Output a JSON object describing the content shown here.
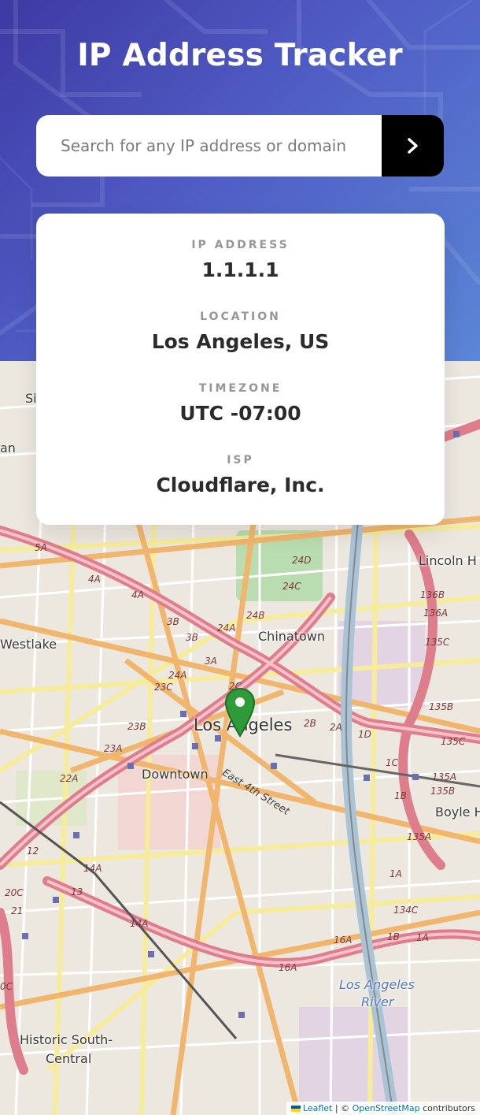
{
  "header": {
    "title": "IP Address Tracker"
  },
  "search": {
    "placeholder": "Search for any IP address or domain",
    "value": ""
  },
  "info": {
    "ip_label": "IP ADDRESS",
    "ip_value": "1.1.1.1",
    "location_label": "LOCATION",
    "location_value": "Los Angeles, US",
    "timezone_label": "TIMEZONE",
    "timezone_value": "UTC -07:00",
    "isp_label": "ISP",
    "isp_value": "Cloudflare, Inc."
  },
  "map": {
    "labels": {
      "westlake": "Westlake",
      "chinatown": "Chinatown",
      "los_angeles": "Los Angeles",
      "downtown": "Downtown",
      "lincoln": "Lincoln H",
      "boyle": "Boyle H",
      "historic_1": "Historic South-",
      "historic_2": "Central",
      "river_1": "Los Angeles",
      "river_2": "River",
      "east_4th": "East 4th Street",
      "si": "Si",
      "an": "an"
    },
    "roads": [
      "5A",
      "4A",
      "4A",
      "3B",
      "3B",
      "3A",
      "24A",
      "23C",
      "23B",
      "23A",
      "22A",
      "24A",
      "24B",
      "24C",
      "24D",
      "2C",
      "2B",
      "2A",
      "1D",
      "1C",
      "1B",
      "1A",
      "136B",
      "136A",
      "135C",
      "135B",
      "135C",
      "135A",
      "135B",
      "135A",
      "134C",
      "16A",
      "16A",
      "1B",
      "1A",
      "14A",
      "14A",
      "13",
      "20C",
      "21",
      "12",
      "0C"
    ]
  },
  "attribution": {
    "leaflet": "Leaflet",
    "sep": " | © ",
    "osm": "OpenStreetMap",
    "rest": " contributors"
  },
  "colors": {
    "accent": "#000000",
    "marker": "#2e9a3a",
    "header_start": "#3d3aa2",
    "header_end": "#5b86d6"
  }
}
